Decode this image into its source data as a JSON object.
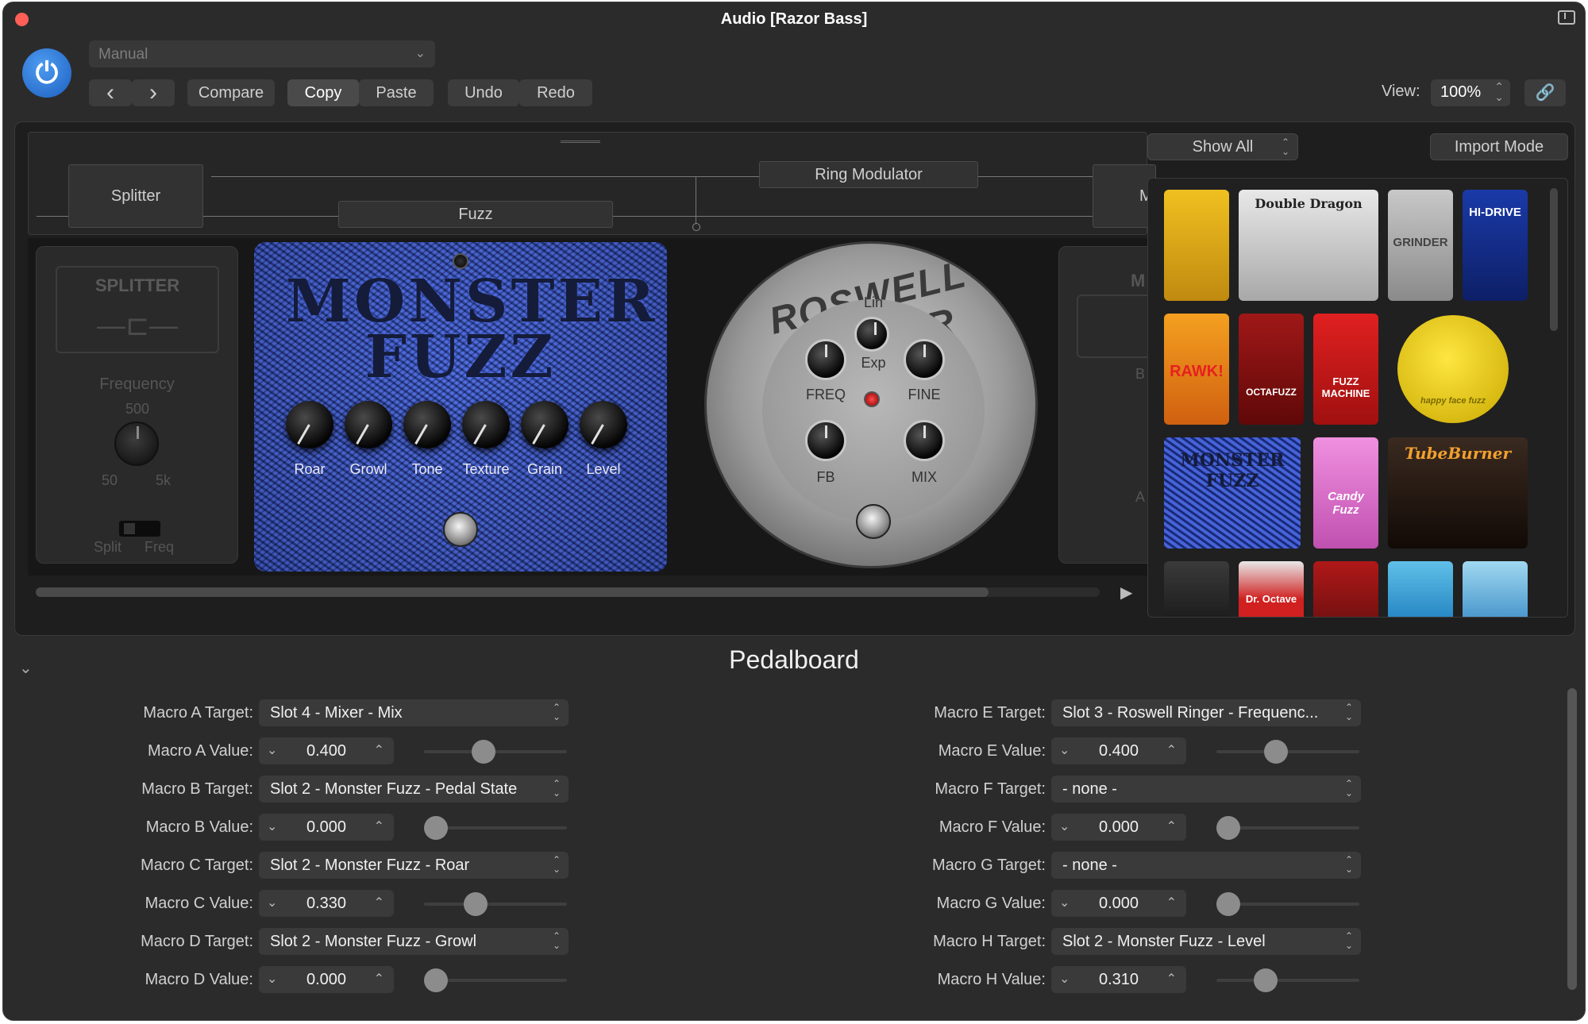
{
  "window": {
    "title": "Audio [Razor Bass]"
  },
  "toolbar": {
    "preset": "Manual",
    "prev": "‹",
    "next": "›",
    "compare": "Compare",
    "copy": "Copy",
    "paste": "Paste",
    "undo": "Undo",
    "redo": "Redo",
    "view_label": "View:",
    "view_value": "100%"
  },
  "routing": {
    "splitter": "Splitter",
    "fuzz": "Fuzz",
    "ring_modulator": "Ring Modulator",
    "mixer_partial": "M"
  },
  "pedals": {
    "splitter": {
      "title": "SPLITTER",
      "frequency_label": "Frequency",
      "freq_mid": "500",
      "freq_min": "50",
      "freq_max": "5k",
      "split_label": "Split",
      "freq_label": "Freq"
    },
    "monster_fuzz": {
      "title": "MONSTER FUZZ",
      "knobs": [
        "Roar",
        "Growl",
        "Tone",
        "Texture",
        "Grain",
        "Level"
      ]
    },
    "roswell_ringer": {
      "title": "ROSWELL RINGER",
      "lin": "Lin",
      "exp": "Exp",
      "freq": "FREQ",
      "fine": "FINE",
      "fb": "FB",
      "mix": "MIX"
    },
    "mixer_partial": {
      "letter_m": "M",
      "letter_b": "B",
      "letter_a": "A"
    }
  },
  "library": {
    "show_all": "Show All",
    "import_mode": "Import Mode",
    "items": {
      "double_dragon": "Double Dragon",
      "grinder": "GRINDER",
      "hi_drive": "HI-DRIVE",
      "rawk": "RAWK!",
      "octafuzz": "OCTAFUZZ",
      "fuzz_machine": "FUZZ MACHINE",
      "happy_face": "happy face fuzz",
      "monster_fuzz": "MONSTER FUZZ",
      "candy_fuzz": "Candy Fuzz",
      "tube_burner": "TubeBurner",
      "dr_octave": "Dr. Octave"
    }
  },
  "pedalboard": {
    "title": "Pedalboard",
    "macros_left": [
      {
        "target_label": "Macro A Target:",
        "target": "Slot 4 - Mixer - Mix",
        "value_label": "Macro A Value:",
        "value": "0.400",
        "level": 0.4
      },
      {
        "target_label": "Macro B Target:",
        "target": "Slot 2 - Monster Fuzz - Pedal State",
        "value_label": "Macro B Value:",
        "value": "0.000",
        "level": 0.0
      },
      {
        "target_label": "Macro C Target:",
        "target": "Slot 2 - Monster Fuzz - Roar",
        "value_label": "Macro C Value:",
        "value": "0.330",
        "level": 0.33
      },
      {
        "target_label": "Macro D Target:",
        "target": "Slot 2 - Monster Fuzz - Growl",
        "value_label": "Macro D Value:",
        "value": "0.000",
        "level": 0.0
      }
    ],
    "macros_right": [
      {
        "target_label": "Macro E Target:",
        "target": "Slot 3 - Roswell Ringer - Frequenc...",
        "value_label": "Macro E Value:",
        "value": "0.400",
        "level": 0.4
      },
      {
        "target_label": "Macro F Target:",
        "target": "- none -",
        "value_label": "Macro F Value:",
        "value": "0.000",
        "level": 0.0
      },
      {
        "target_label": "Macro G Target:",
        "target": "- none -",
        "value_label": "Macro G Value:",
        "value": "0.000",
        "level": 0.0
      },
      {
        "target_label": "Macro H Target:",
        "target": "Slot 2 - Monster Fuzz - Level",
        "value_label": "Macro H Value:",
        "value": "0.310",
        "level": 0.31
      }
    ]
  },
  "colors": {
    "power_blue": "#2a74d6",
    "fuzz_blue": "#3450c4",
    "panel": "#2b2b2b"
  }
}
